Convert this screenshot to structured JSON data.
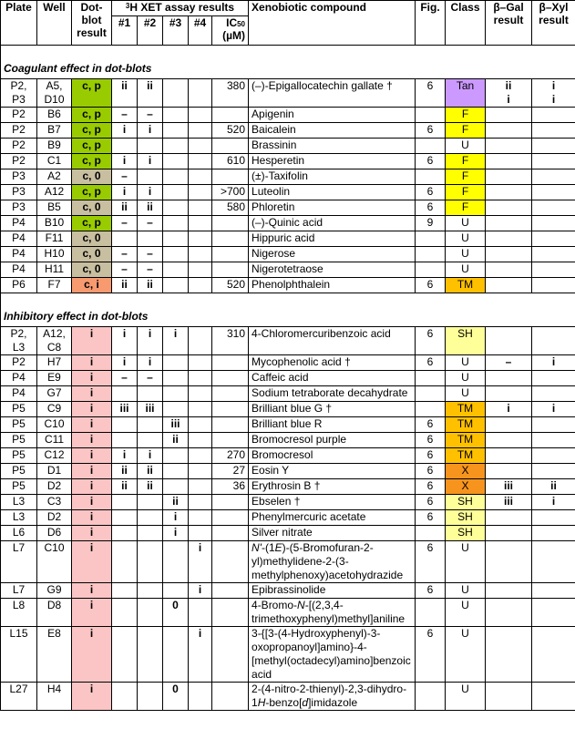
{
  "header": {
    "plate": "Plate",
    "well": "Well",
    "dot_blot": "Dot-blot result",
    "xet_prefix": "3",
    "xet_title": "H XET assay results",
    "n1": "#1",
    "n2": "#2",
    "n3": "#3",
    "n4": "#4",
    "ic50_main": "IC",
    "ic50_sub": "50",
    "ic50_unit": "(µM)",
    "compound": "Xenobiotic compound",
    "fig": "Fig.",
    "class": "Class",
    "bgal": "β–Gal result",
    "bxyl": "β–Xyl result"
  },
  "colors": {
    "dot_cp": "#99cc00",
    "dot_c0": "#c8bea0",
    "dot_ci": "#f79a70",
    "dot_i": "#fbc5c5",
    "class_Tan": "#cc99ff",
    "class_F": "#ffff00",
    "class_TM": "#ffc000",
    "class_SH": "#ffff99",
    "class_X": "#f7941d"
  },
  "sections": [
    {
      "title": "Coagulant effect in dot-blots",
      "rows": [
        {
          "plate": "P2,\nP3",
          "well": "A5,\nD10",
          "dot": "c, p",
          "dot_cls": "cp",
          "r1": "ii",
          "r2": "ii",
          "r3": "",
          "r4": "",
          "ic50": "380",
          "compound": "(–)-Epigallocatechin gallate †",
          "fig": "6",
          "class": "Tan",
          "bgal": "ii\ni",
          "bxyl": "i\ni"
        },
        {
          "plate": "P2",
          "well": "B6",
          "dot": "c, p",
          "dot_cls": "cp",
          "r1": "–",
          "r2": "–",
          "r3": "",
          "r4": "",
          "ic50": "",
          "compound": "Apigenin",
          "fig": "",
          "class": "F",
          "bgal": "",
          "bxyl": ""
        },
        {
          "plate": "P2",
          "well": "B7",
          "dot": "c, p",
          "dot_cls": "cp",
          "r1": "i",
          "r2": "i",
          "r3": "",
          "r4": "",
          "ic50": "520",
          "compound": "Baicalein",
          "fig": "6",
          "class": "F",
          "bgal": "",
          "bxyl": ""
        },
        {
          "plate": "P2",
          "well": "B9",
          "dot": "c, p",
          "dot_cls": "cp",
          "r1": "",
          "r2": "",
          "r3": "",
          "r4": "",
          "ic50": "",
          "compound": "Brassinin",
          "fig": "",
          "class": "U",
          "bgal": "",
          "bxyl": ""
        },
        {
          "plate": "P2",
          "well": "C1",
          "dot": "c, p",
          "dot_cls": "cp",
          "r1": "i",
          "r2": "i",
          "r3": "",
          "r4": "",
          "ic50": "610",
          "compound": "Hesperetin",
          "fig": "6",
          "class": "F",
          "bgal": "",
          "bxyl": ""
        },
        {
          "plate": "P3",
          "well": "A2",
          "dot": "c, 0",
          "dot_cls": "c0",
          "r1": "–",
          "r2": "",
          "r3": "",
          "r4": "",
          "ic50": "",
          "compound": "(±)-Taxifolin",
          "fig": "",
          "class": "F",
          "bgal": "",
          "bxyl": ""
        },
        {
          "plate": "P3",
          "well": "A12",
          "dot": "c, p",
          "dot_cls": "cp",
          "r1": "i",
          "r2": "i",
          "r3": "",
          "r4": "",
          "ic50": ">700",
          "compound": "Luteolin",
          "fig": "6",
          "class": "F",
          "bgal": "",
          "bxyl": ""
        },
        {
          "plate": "P3",
          "well": "B5",
          "dot": "c, 0",
          "dot_cls": "c0",
          "r1": "ii",
          "r2": "ii",
          "r3": "",
          "r4": "",
          "ic50": "580",
          "compound": "Phloretin",
          "fig": "6",
          "class": "F",
          "bgal": "",
          "bxyl": ""
        },
        {
          "plate": "P4",
          "well": "B10",
          "dot": "c, p",
          "dot_cls": "cp",
          "r1": "–",
          "r2": "–",
          "r3": "",
          "r4": "",
          "ic50": "",
          "compound": "(–)-Quinic acid",
          "fig": "9",
          "class": "U",
          "bgal": "",
          "bxyl": ""
        },
        {
          "plate": "P4",
          "well": "F11",
          "dot": "c, 0",
          "dot_cls": "c0",
          "r1": "",
          "r2": "",
          "r3": "",
          "r4": "",
          "ic50": "",
          "compound": "Hippuric acid",
          "fig": "",
          "class": "U",
          "bgal": "",
          "bxyl": ""
        },
        {
          "plate": "P4",
          "well": "H10",
          "dot": "c, 0",
          "dot_cls": "c0",
          "r1": "–",
          "r2": "–",
          "r3": "",
          "r4": "",
          "ic50": "",
          "compound": "Nigerose",
          "fig": "",
          "class": "U",
          "bgal": "",
          "bxyl": ""
        },
        {
          "plate": "P4",
          "well": "H11",
          "dot": "c, 0",
          "dot_cls": "c0",
          "r1": "–",
          "r2": "–",
          "r3": "",
          "r4": "",
          "ic50": "",
          "compound": "Nigerotetraose",
          "fig": "",
          "class": "U",
          "bgal": "",
          "bxyl": ""
        },
        {
          "plate": "P6",
          "well": "F7",
          "dot": "c, i",
          "dot_cls": "ci",
          "r1": "ii",
          "r2": "ii",
          "r3": "",
          "r4": "",
          "ic50": "520",
          "compound": "Phenolphthalein",
          "fig": "6",
          "class": "TM",
          "bgal": "",
          "bxyl": ""
        }
      ]
    },
    {
      "title": "Inhibitory effect in dot-blots",
      "rows": [
        {
          "plate": "P2,\nL3",
          "well": "A12,\nC8",
          "dot": "i",
          "dot_cls": "ii",
          "r1": "i",
          "r2": "i",
          "r3": "i",
          "r4": "",
          "ic50": "310",
          "compound": "4-Chloromercuribenzoic acid",
          "fig": "6",
          "class": "SH",
          "bgal": "",
          "bxyl": ""
        },
        {
          "plate": "P2",
          "well": "H7",
          "dot": "i",
          "dot_cls": "ii",
          "r1": "i",
          "r2": "i",
          "r3": "",
          "r4": "",
          "ic50": "",
          "compound": "Mycophenolic acid †",
          "fig": "6",
          "class": "U",
          "bgal": "–",
          "bxyl": "i"
        },
        {
          "plate": "P4",
          "well": "E9",
          "dot": "i",
          "dot_cls": "ii",
          "r1": "–",
          "r2": "–",
          "r3": "",
          "r4": "",
          "ic50": "",
          "compound": "Caffeic acid",
          "fig": "",
          "class": "U",
          "bgal": "",
          "bxyl": ""
        },
        {
          "plate": "P4",
          "well": "G7",
          "dot": "i",
          "dot_cls": "ii",
          "r1": "",
          "r2": "",
          "r3": "",
          "r4": "",
          "ic50": "",
          "compound": "Sodium tetraborate decahydrate",
          "fig": "",
          "class": "U",
          "bgal": "",
          "bxyl": ""
        },
        {
          "plate": "P5",
          "well": "C9",
          "dot": "i",
          "dot_cls": "ii",
          "r1": "iii",
          "r2": "iii",
          "r3": "",
          "r4": "",
          "ic50": "",
          "compound": "Brilliant blue G †",
          "fig": "",
          "class": "TM",
          "bgal": "i",
          "bxyl": "i"
        },
        {
          "plate": "P5",
          "well": "C10",
          "dot": "i",
          "dot_cls": "ii",
          "r1": "",
          "r2": "",
          "r3": "iii",
          "r4": "",
          "ic50": "",
          "compound": "Brilliant blue R",
          "fig": "6",
          "class": "TM",
          "bgal": "",
          "bxyl": ""
        },
        {
          "plate": "P5",
          "well": "C11",
          "dot": "i",
          "dot_cls": "ii",
          "r1": "",
          "r2": "",
          "r3": "ii",
          "r4": "",
          "ic50": "",
          "compound": "Bromocresol purple",
          "fig": "6",
          "class": "TM",
          "bgal": "",
          "bxyl": ""
        },
        {
          "plate": "P5",
          "well": "C12",
          "dot": "i",
          "dot_cls": "ii",
          "r1": "i",
          "r2": "i",
          "r3": "",
          "r4": "",
          "ic50": "270",
          "compound": "Bromocresol",
          "fig": "6",
          "class": "TM",
          "bgal": "",
          "bxyl": ""
        },
        {
          "plate": "P5",
          "well": "D1",
          "dot": "i",
          "dot_cls": "ii",
          "r1": "ii",
          "r2": "ii",
          "r3": "",
          "r4": "",
          "ic50": "27",
          "compound": "Eosin Y",
          "fig": "6",
          "class": "X",
          "bgal": "",
          "bxyl": ""
        },
        {
          "plate": "P5",
          "well": "D2",
          "dot": "i",
          "dot_cls": "ii",
          "r1": "ii",
          "r2": "ii",
          "r3": "",
          "r4": "",
          "ic50": "36",
          "compound": "Erythrosin B †",
          "fig": "6",
          "class": "X",
          "bgal": "iii",
          "bxyl": "ii"
        },
        {
          "plate": "L3",
          "well": "C3",
          "dot": "i",
          "dot_cls": "ii",
          "r1": "",
          "r2": "",
          "r3": "ii",
          "r4": "",
          "ic50": "",
          "compound": "Ebselen †",
          "fig": "6",
          "class": "SH",
          "bgal": "iii",
          "bxyl": "i"
        },
        {
          "plate": "L3",
          "well": "D2",
          "dot": "i",
          "dot_cls": "ii",
          "r1": "",
          "r2": "",
          "r3": "i",
          "r4": "",
          "ic50": "",
          "compound": "Phenylmercuric acetate",
          "fig": "6",
          "class": "SH",
          "bgal": "",
          "bxyl": ""
        },
        {
          "plate": "L6",
          "well": "D6",
          "dot": "i",
          "dot_cls": "ii",
          "r1": "",
          "r2": "",
          "r3": "i",
          "r4": "",
          "ic50": "",
          "compound": "Silver nitrate",
          "fig": "",
          "class": "SH",
          "bgal": "",
          "bxyl": ""
        },
        {
          "plate": "L7",
          "well": "C10",
          "dot": "i",
          "dot_cls": "ii",
          "r1": "",
          "r2": "",
          "r3": "",
          "r4": "i",
          "ic50": "",
          "compound": "N'-(1E)-(5-Bromofuran-2-yl)methylidene-2-(3-methylphenoxy)acetohydrazide",
          "fig": "6",
          "class": "U",
          "bgal": "",
          "bxyl": ""
        },
        {
          "plate": "L7",
          "well": "G9",
          "dot": "i",
          "dot_cls": "ii",
          "r1": "",
          "r2": "",
          "r3": "",
          "r4": "i",
          "ic50": "",
          "compound": "Epibrassinolide",
          "fig": "6",
          "class": "U",
          "bgal": "",
          "bxyl": ""
        },
        {
          "plate": "L8",
          "well": "D8",
          "dot": "i",
          "dot_cls": "ii",
          "r1": "",
          "r2": "",
          "r3": "0",
          "r4": "",
          "ic50": "",
          "compound": "4-Bromo-N-[(2,3,4-trimethoxyphenyl)methyl]aniline",
          "fig": "",
          "class": "U",
          "bgal": "",
          "bxyl": ""
        },
        {
          "plate": "L15",
          "well": "E8",
          "dot": "i",
          "dot_cls": "ii",
          "r1": "",
          "r2": "",
          "r3": "",
          "r4": "i",
          "ic50": "",
          "compound": "3-{[3-(4-Hydroxyphenyl)-3-oxopropanoyl]amino}-4-[methyl(octadecyl)amino]benzoic acid",
          "fig": "6",
          "class": "U",
          "bgal": "",
          "bxyl": ""
        },
        {
          "plate": "L27",
          "well": "H4",
          "dot": "i",
          "dot_cls": "ii",
          "r1": "",
          "r2": "",
          "r3": "0",
          "r4": "",
          "ic50": "",
          "compound": "2-(4-nitro-2-thienyl)-2,3-dihydro-1H-benzo[d]imidazole",
          "fig": "",
          "class": "U",
          "bgal": "",
          "bxyl": ""
        }
      ]
    }
  ]
}
